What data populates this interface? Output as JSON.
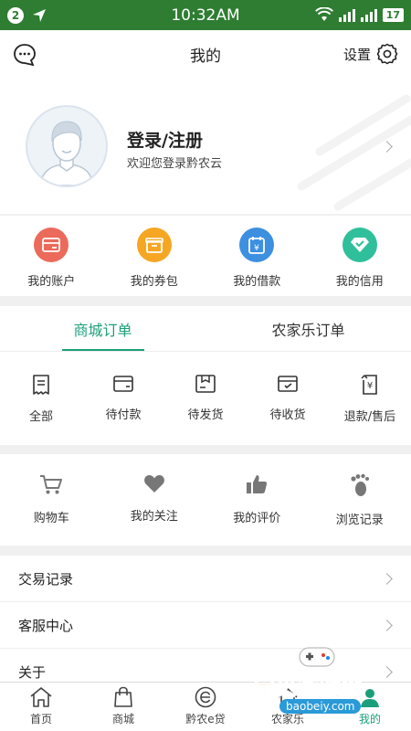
{
  "status_bar": {
    "notif_count": "2",
    "time": "10:32AM",
    "battery": "17"
  },
  "header": {
    "title": "我的",
    "settings_label": "设置",
    "message_icon": "chat-bubble-icon",
    "settings_icon": "gear-icon"
  },
  "profile": {
    "login_title": "登录/注册",
    "welcome_text": "欢迎您登录黔农云"
  },
  "quick_actions": [
    {
      "label": "我的账户",
      "icon": "wallet-icon",
      "color": "#ec6a5a"
    },
    {
      "label": "我的券包",
      "icon": "coupon-box-icon",
      "color": "#f5a623"
    },
    {
      "label": "我的借款",
      "icon": "yuan-calendar-icon",
      "color": "#3d8fe0"
    },
    {
      "label": "我的信用",
      "icon": "diamond-check-icon",
      "color": "#2fbf9b"
    }
  ],
  "orders": {
    "tabs": [
      "商城订单",
      "农家乐订单"
    ],
    "active_tab": 0,
    "items": [
      {
        "label": "全部",
        "icon": "receipt-icon"
      },
      {
        "label": "待付款",
        "icon": "card-icon"
      },
      {
        "label": "待发货",
        "icon": "package-icon"
      },
      {
        "label": "待收货",
        "icon": "delivery-box-icon"
      },
      {
        "label": "退款/售后",
        "icon": "refund-icon"
      }
    ]
  },
  "favorites": [
    {
      "label": "购物车",
      "icon": "cart-icon"
    },
    {
      "label": "我的关注",
      "icon": "heart-icon"
    },
    {
      "label": "我的评价",
      "icon": "thumbs-up-icon"
    },
    {
      "label": "浏览记录",
      "icon": "footprint-icon"
    }
  ],
  "menu_list": [
    {
      "label": "交易记录"
    },
    {
      "label": "客服中心"
    },
    {
      "label": "关于"
    }
  ],
  "tab_bar": {
    "items": [
      {
        "label": "首页",
        "icon": "home-icon"
      },
      {
        "label": "商城",
        "icon": "shopping-bag-icon"
      },
      {
        "label": "黔农e贷",
        "icon": "e-loan-icon"
      },
      {
        "label": "农家乐",
        "icon": "farmhouse-icon"
      },
      {
        "label": "我的",
        "icon": "profile-icon"
      }
    ],
    "active": 4
  },
  "watermark": {
    "text": "宝贝游戏网",
    "url": "baobeiy.com"
  },
  "colors": {
    "status_bar": "#2e7d32",
    "accent": "#1b9f7a"
  }
}
